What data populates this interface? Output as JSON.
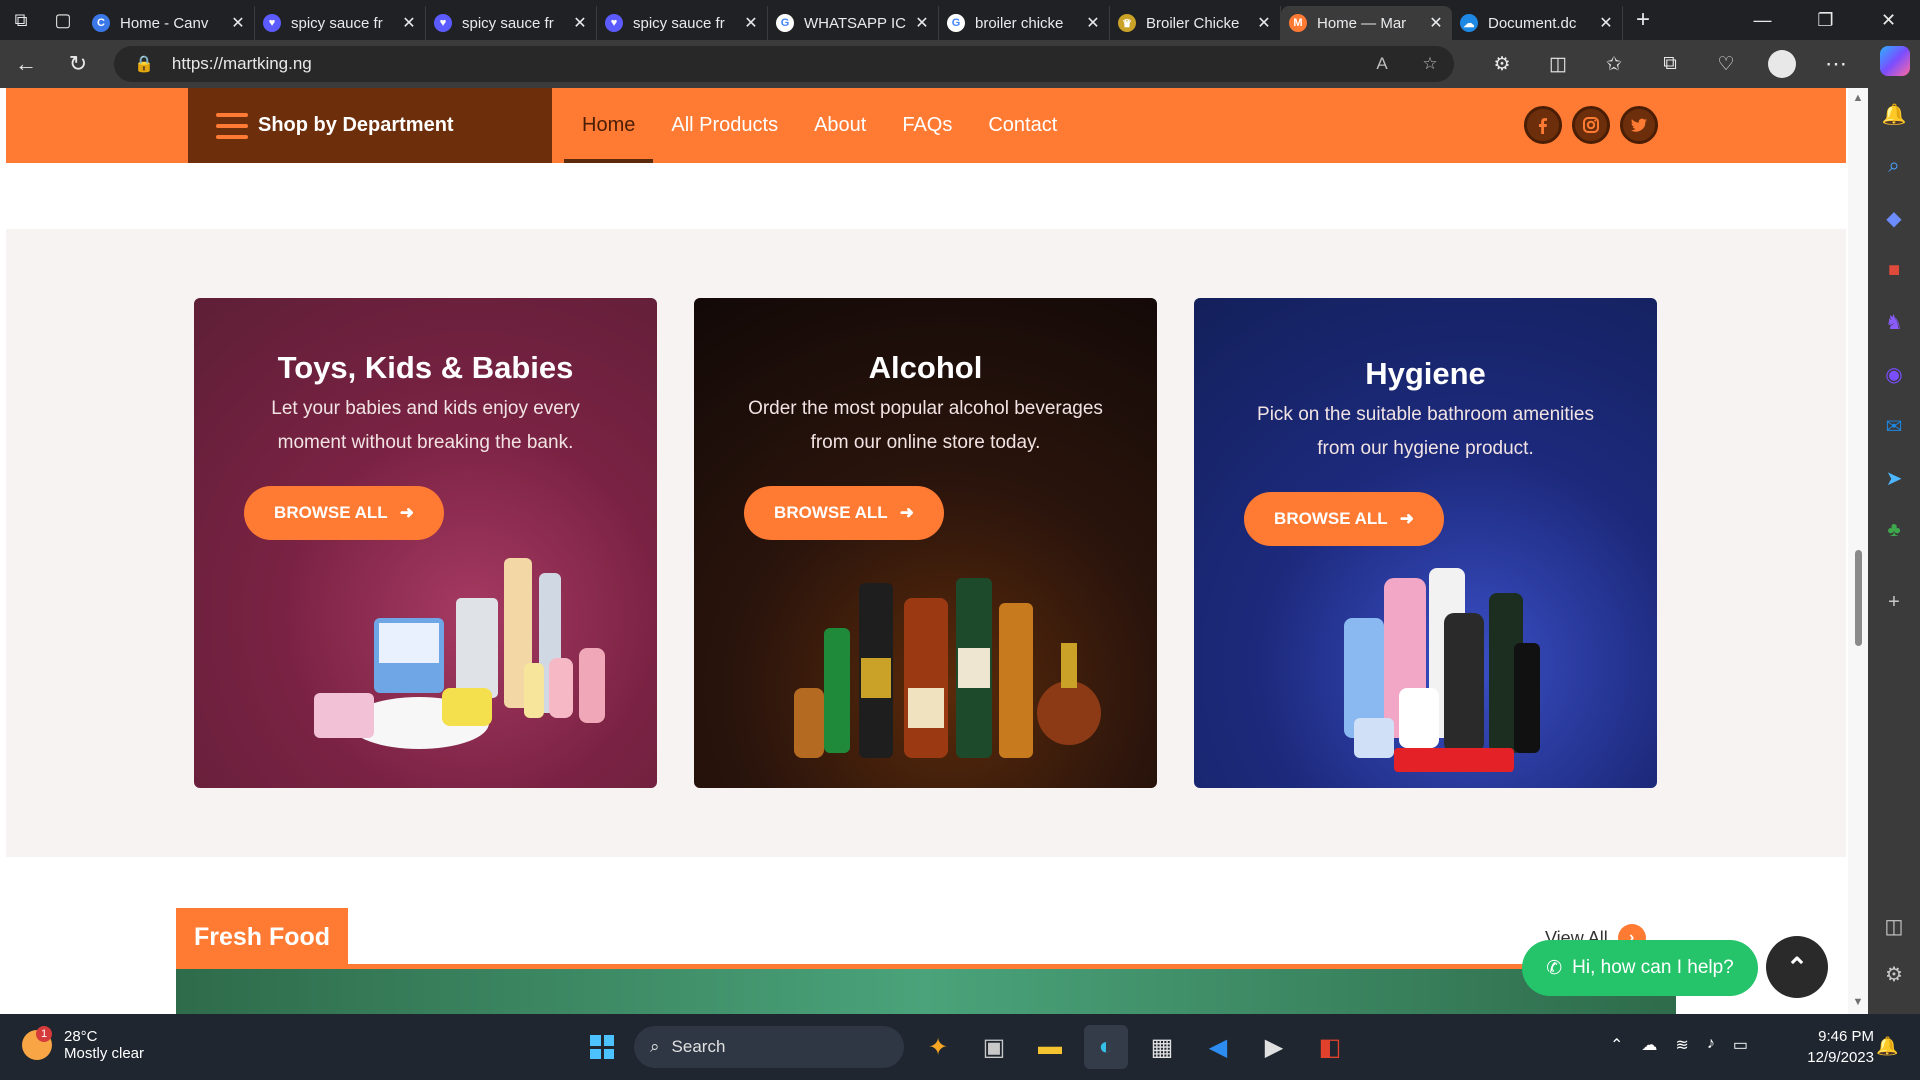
{
  "browser": {
    "tabs": [
      {
        "label": "Home - Canv",
        "favicon_color": "#3b78e7",
        "favicon_glyph": "C"
      },
      {
        "label": "spicy sauce fr",
        "favicon_color": "#5b5bff",
        "favicon_glyph": "♥"
      },
      {
        "label": "spicy sauce fr",
        "favicon_color": "#5b5bff",
        "favicon_glyph": "♥"
      },
      {
        "label": "spicy sauce fr",
        "favicon_color": "#5b5bff",
        "favicon_glyph": "♥"
      },
      {
        "label": "WHATSAPP IC",
        "favicon_color": "#ffffff",
        "favicon_glyph": "G"
      },
      {
        "label": "broiler chicke",
        "favicon_color": "#ffffff",
        "favicon_glyph": "G"
      },
      {
        "label": "Broiler Chicke",
        "favicon_color": "#c9a227",
        "favicon_glyph": "♛"
      },
      {
        "label": "Home — Mar",
        "favicon_color": "#ff7b33",
        "favicon_glyph": "M"
      },
      {
        "label": "Document.dc",
        "favicon_color": "#1e88e5",
        "favicon_glyph": "☁"
      }
    ],
    "url": "https://martking.ng"
  },
  "site": {
    "dept_label": "Shop by Department",
    "menu": [
      "Home",
      "All Products",
      "About",
      "FAQs",
      "Contact"
    ],
    "social": [
      "facebook-icon",
      "instagram-icon",
      "twitter-icon"
    ]
  },
  "cards": [
    {
      "title": "Toys, Kids & Babies",
      "desc": "Let your babies and kids enjoy every moment without breaking the bank.",
      "button": "BROWSE ALL"
    },
    {
      "title": "Alcohol",
      "desc": "Order the most popular alcohol beverages from our online store today.",
      "button": "BROWSE ALL"
    },
    {
      "title": "Hygiene",
      "desc": "Pick on the suitable bathroom amenities from our hygiene product.",
      "button": "BROWSE ALL"
    }
  ],
  "fresh": {
    "title": "Fresh Food",
    "view_all": "View All"
  },
  "chat": {
    "label": "Hi, how can I help?"
  },
  "taskbar": {
    "temp": "28°C",
    "condition": "Mostly clear",
    "badge": "1",
    "search": "Search",
    "time": "9:46 PM",
    "date": "12/9/2023"
  },
  "colors": {
    "brand_orange": "#ff7b33",
    "dept_brown": "#6d2f0b",
    "chat_green": "#25c36a"
  }
}
